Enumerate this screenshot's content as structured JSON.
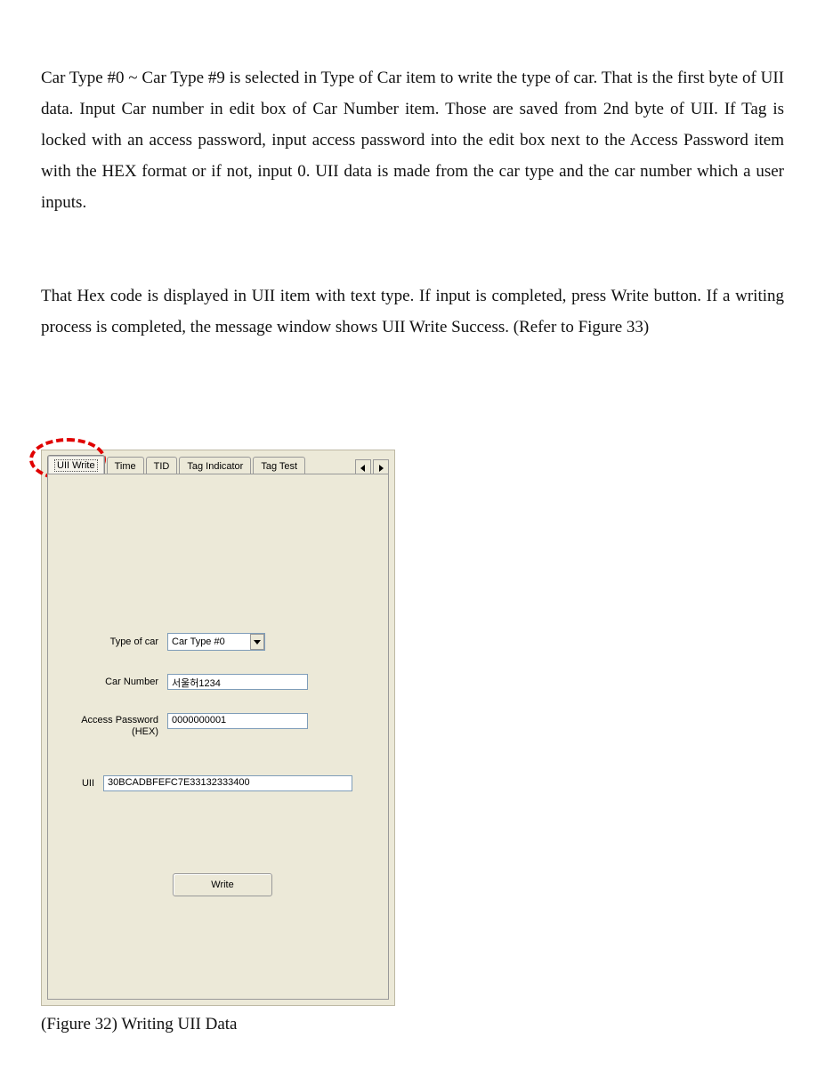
{
  "body": {
    "p1": "Car Type #0 ~ Car Type #9 is selected in Type of Car item to write the type of car. That is the first byte of UII data. Input Car number in edit box of Car Number item. Those are saved from 2nd byte of UII. If Tag is locked with an access password, input access password into the edit box next to the Access Password item with the HEX format or if not, input 0. UII data is made from the car type and the car number which a user inputs.",
    "p2": "That Hex code is displayed in UII item with text type. If input is completed, press Write button. If a writing process is completed, the message window shows UII Write Success. (Refer to Figure 33)"
  },
  "tabs": {
    "t0": "UII Write",
    "t1": "Time",
    "t2": "TID",
    "t3": "Tag Indicator",
    "t4": "Tag Test"
  },
  "form": {
    "type_label": "Type of car",
    "type_value": "Car Type #0",
    "carnum_label": "Car Number",
    "carnum_value": "서울허1234",
    "accpwd_label": "Access Password (HEX)",
    "accpwd_value": "0000000001",
    "uii_label": "UII",
    "uii_value": "30BCADBFEFC7E33132333400",
    "write_button": "Write"
  },
  "figure_caption": "(Figure 32) Writing UII Data"
}
